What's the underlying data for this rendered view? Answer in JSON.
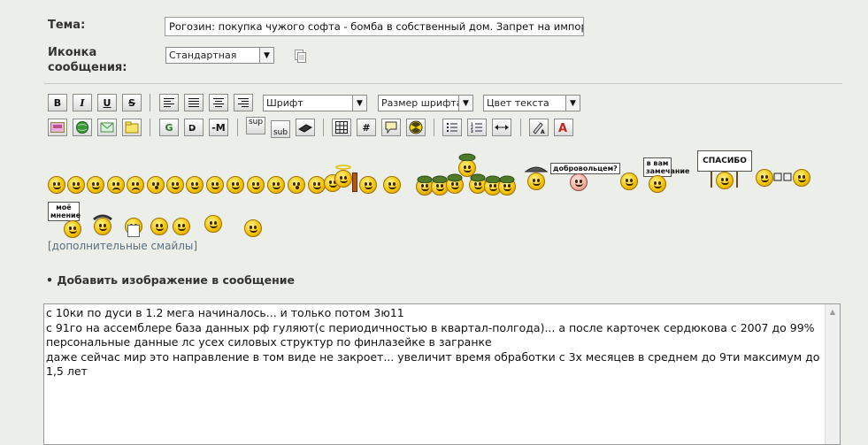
{
  "form": {
    "topic_label": "Тема:",
    "topic_value": "Рогозин: покупка чужого софта - бомба в собственный дом. Запрет на импортно",
    "icon_label_line1": "Иконка",
    "icon_label_line2": "сообщения:",
    "icon_select_value": "Стандартная"
  },
  "toolbar": {
    "bold": "B",
    "italic": "I",
    "underline": "U",
    "strike": "S",
    "font_select": "Шрифт",
    "size_select": "Размер шрифта",
    "color_select": "Цвет текста",
    "google": "G",
    "hr": "-M",
    "sup": "sup",
    "sub": "sub",
    "hash": "#"
  },
  "smilies": {
    "signs": {
      "volunteers": "добровольцем?",
      "remark_line1": "в вам",
      "remark_line2": "замечание",
      "thanks": "СПАСИБО !",
      "opinion_line1": "моё",
      "opinion_line2": "мнение"
    },
    "more_link": "[дополнительные смайлы]"
  },
  "add_image": "• Добавить изображение в сообщение",
  "message": {
    "text": "с 10ки по дуси в 1.2 мега начиналось... и только потом 3ю11\nс 91го на ассемблере база данных рф гуляют(с периодичностью в квартал-полгода)... а после карточек сердюкова с 2007 до 99%\nперсональные данные лс усех силовых структур по финлазейке в загранке\nдаже сейчас мир это направление в том виде не закроет... увеличит время обработки с 3х месяцев в среднем до 9ти максимум до\n1,5 лет"
  },
  "colors": {
    "background": "#eceee9",
    "link": "#5a6d7d",
    "smiley": "#f2c100"
  }
}
